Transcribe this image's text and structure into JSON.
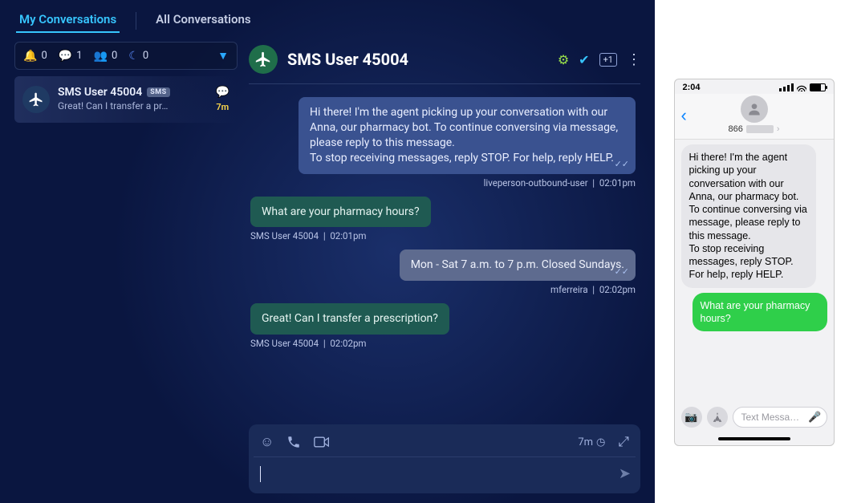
{
  "tabs": {
    "my": "My Conversations",
    "all": "All Conversations",
    "active": "my"
  },
  "counters": {
    "bell": "0",
    "chat": "1",
    "group": "0",
    "moon": "0"
  },
  "conversation_item": {
    "title": "SMS User 45004",
    "badge": "SMS",
    "preview": "Great! Can I transfer a pr…",
    "age": "7m"
  },
  "chat_header": {
    "title": "SMS User 45004",
    "plus": "+1"
  },
  "messages": [
    {
      "side": "right",
      "style": "agent-blue",
      "text": "Hi there! I'm the agent picking up your conversation with our Anna, our pharmacy bot. To continue conversing via message, please reply to this message.\nTo stop receiving messages, reply STOP. For help, reply HELP.",
      "from": "liveperson-outbound-user",
      "time": "02:01pm",
      "ticks": true
    },
    {
      "side": "left",
      "style": "user-teal",
      "text": "What are your pharmacy hours?",
      "from": "SMS User 45004",
      "time": "02:01pm"
    },
    {
      "side": "right",
      "style": "agent-grey",
      "text": "Mon - Sat 7 a.m. to 7 p.m. Closed Sundays.",
      "from": "mferreira",
      "time": "02:02pm",
      "ticks": true
    },
    {
      "side": "left",
      "style": "user-teal",
      "text": "Great! Can I transfer a prescription?",
      "from": "SMS User 45004",
      "time": "02:02pm"
    }
  ],
  "composer": {
    "age": "7m"
  },
  "phone": {
    "time": "2:04",
    "contact_prefix": "866",
    "grey_bubble": "Hi there! I'm the agent picking up your conversation with our Anna, our pharmacy bot. To continue conversing via message, please reply to this message.\nTo stop receiving messages, reply STOP. For help, reply HELP.",
    "green_bubble": "What are your pharmacy hours?",
    "input_placeholder": "Text Messa…"
  }
}
